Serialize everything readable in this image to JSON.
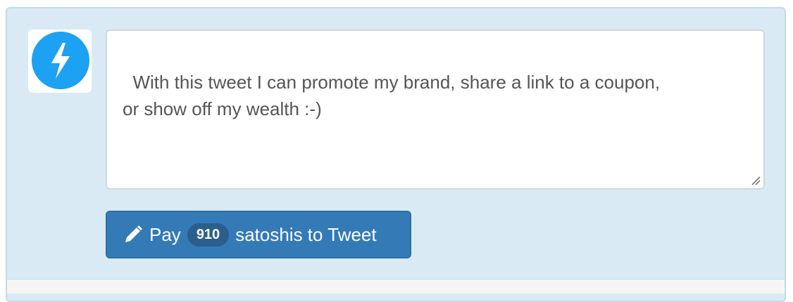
{
  "avatar": {
    "icon": "lightning-bolt-icon",
    "color": "#1da1f2"
  },
  "tweet": {
    "text": "With this tweet I can promote my brand, share a link to a coupon,\nor show off my wealth :-)"
  },
  "pay_button": {
    "prefix": "Pay",
    "amount": "910",
    "suffix": "satoshis to Tweet",
    "color": "#337ab7"
  }
}
